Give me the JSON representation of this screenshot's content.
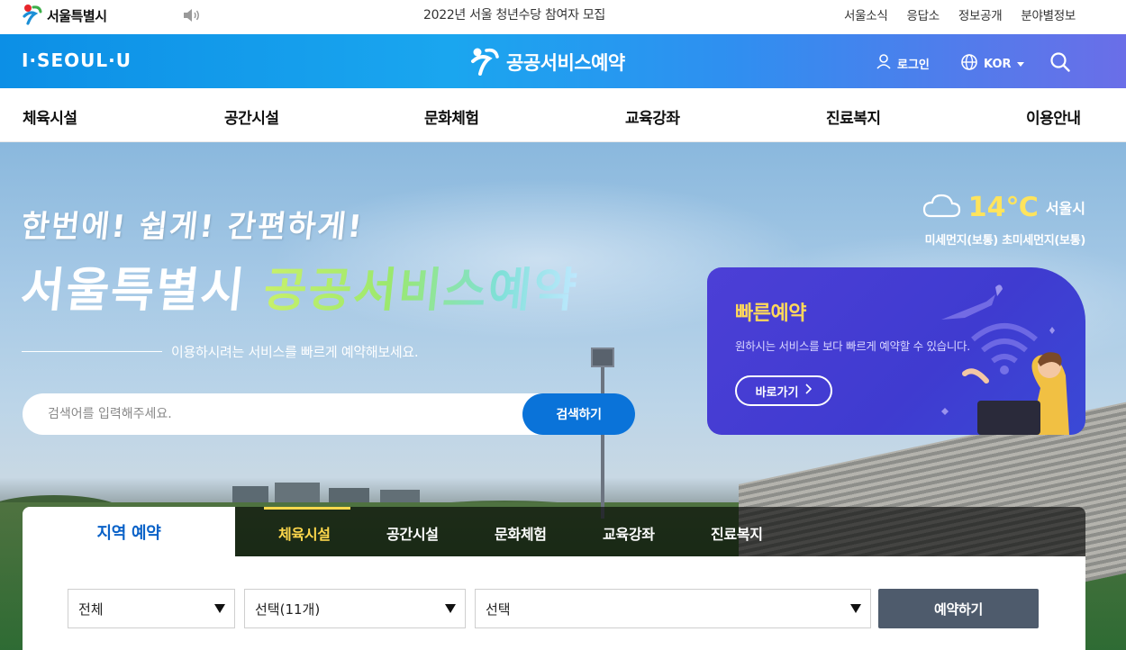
{
  "topbar": {
    "logo_text": "서울특별시",
    "notice": "2022년 서울 청년수당 참여자 모집",
    "links": [
      "서울소식",
      "응답소",
      "정보공개",
      "분야별정보"
    ]
  },
  "header": {
    "iseoulu": "I·SEOUL·U",
    "brand_title": "공공서비스예약",
    "login": "로그인",
    "language": "KOR"
  },
  "nav": {
    "items": [
      "체육시설",
      "공간시설",
      "문화체험",
      "교육강좌",
      "진료복지",
      "이용안내"
    ]
  },
  "hero": {
    "slogan_line1": "한번에! 쉽게! 간편하게!",
    "slogan_city": "서울특별시",
    "slogan_service": "공공서비스예약",
    "subtitle": "이용하시려는 서비스를 빠르게 예약해보세요.",
    "search_placeholder": "검색어를 입력해주세요.",
    "search_button": "검색하기"
  },
  "weather": {
    "temperature": "14℃",
    "city": "서울시",
    "dust": "미세먼지(보통) 초미세먼지(보통)"
  },
  "quick": {
    "title": "빠른예약",
    "description": "원하시는 서비스를 보다 빠르게 예약할 수 있습니다.",
    "button": "바로가기"
  },
  "region": {
    "tab_label": "지역 예약",
    "tabs": [
      "체육시설",
      "공간시설",
      "문화체험",
      "교육강좌",
      "진료복지"
    ],
    "active_tab": "체육시설",
    "select_area": "전체",
    "select_category": "선택(11개)",
    "select_facility": "선택",
    "reserve_button": "예약하기"
  },
  "colors": {
    "header_blue": "#0c8fe6",
    "header_purple": "#6a6ee8",
    "search_blue": "#0a73d9",
    "quick_purple": "#4c3fd6",
    "accent_yellow": "#ffd84c",
    "reserve_gray": "#4e5b6c"
  },
  "icons": [
    "seoul-logo-icon",
    "speaker-icon",
    "iseoulu-logo",
    "service-logo-icon",
    "user-icon",
    "globe-icon",
    "caret-down-icon",
    "search-icon",
    "cloud-icon",
    "chevron-right-icon",
    "dropdown-arrow-icon"
  ]
}
